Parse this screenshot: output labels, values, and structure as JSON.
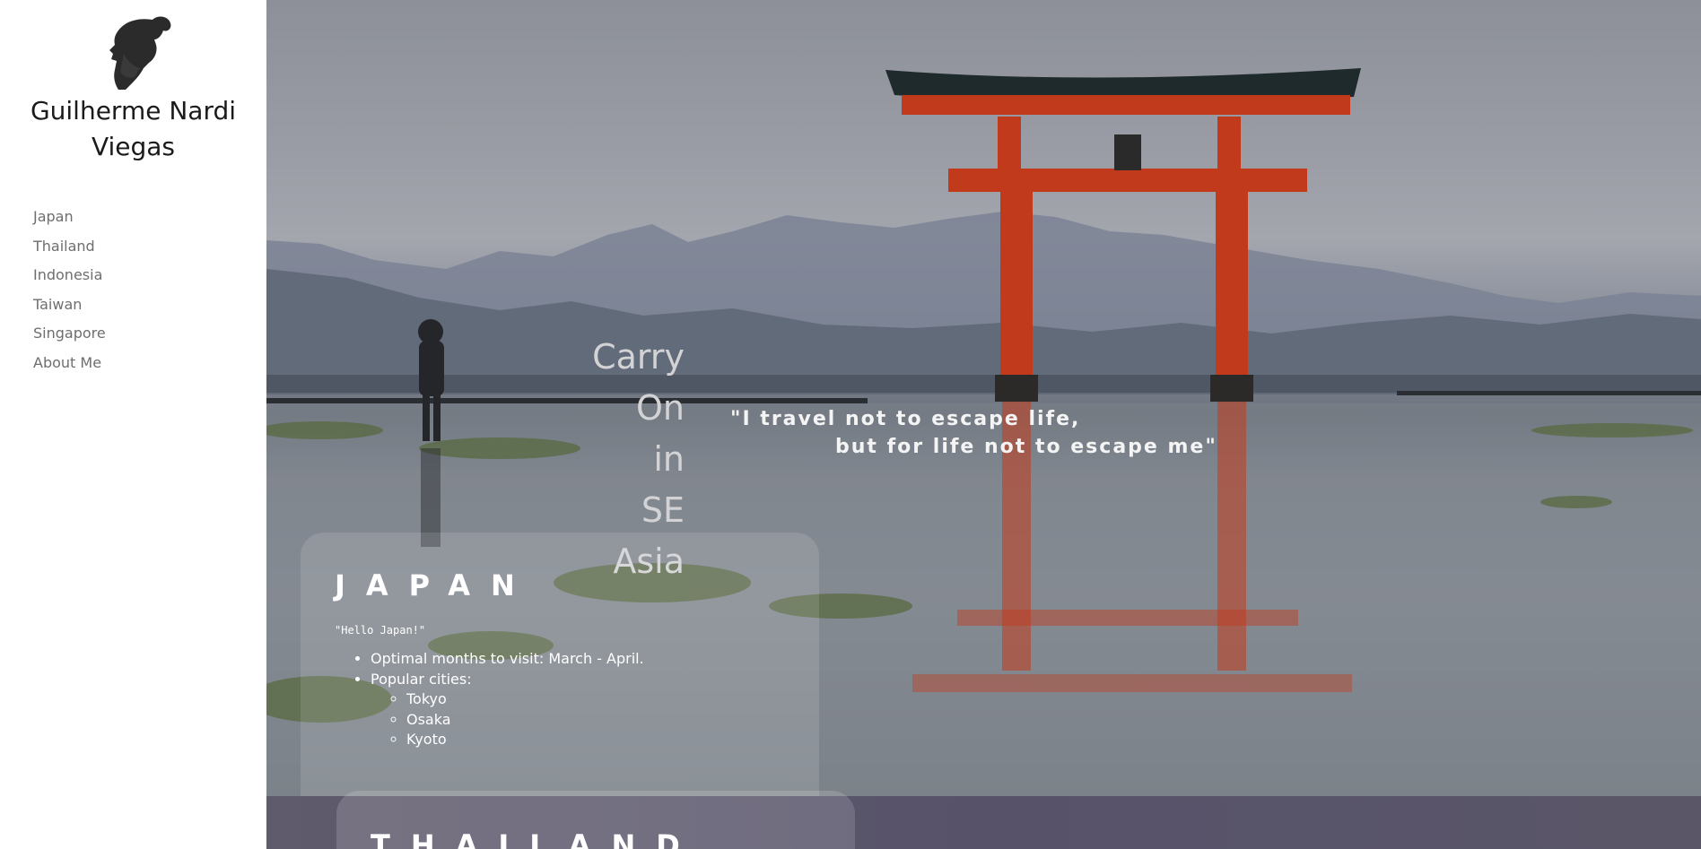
{
  "sidebar": {
    "site_name_line1": "Guilherme Nardi",
    "site_name_line2": "Viegas",
    "nav": [
      {
        "label": "Japan"
      },
      {
        "label": "Thailand"
      },
      {
        "label": "Indonesia"
      },
      {
        "label": "Taiwan"
      },
      {
        "label": "Singapore"
      },
      {
        "label": "About Me"
      }
    ]
  },
  "hero": {
    "headline": [
      "Carry On",
      "in",
      "SE Asia"
    ],
    "quote_line1": "\"I travel not to escape life,",
    "quote_line2": "but for life not to escape me\""
  },
  "sections": [
    {
      "title": "JAPAN",
      "greeting": "\"Hello Japan!\"",
      "items": [
        "Optimal months to visit: March - April.",
        "Popular cities:"
      ],
      "cities": [
        "Tokyo",
        "Osaka",
        "Kyoto"
      ]
    },
    {
      "title": "THAILAND"
    }
  ],
  "colors": {
    "torii": "#c23a1c",
    "sidebar_bg": "#ffffff",
    "nav_text": "#6e6e6e"
  }
}
